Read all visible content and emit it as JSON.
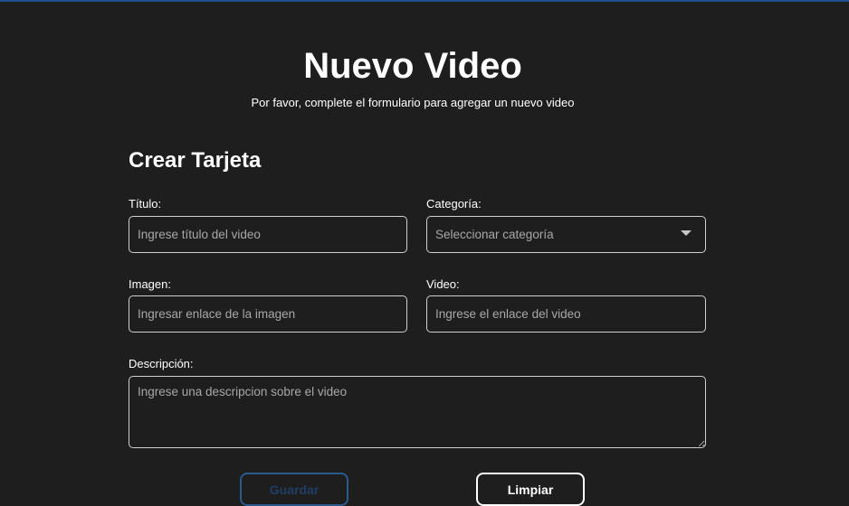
{
  "header": {
    "title": "Nuevo Video",
    "subtitle": "Por favor, complete el formulario para agregar un nuevo video"
  },
  "form": {
    "heading": "Crear Tarjeta",
    "title_field": {
      "label": "Título:",
      "placeholder": "Ingrese título del video",
      "value": ""
    },
    "category_field": {
      "label": "Categoría:",
      "selected": "Seleccionar categoría"
    },
    "image_field": {
      "label": "Imagen:",
      "placeholder": "Ingresar enlace de la imagen",
      "value": ""
    },
    "video_field": {
      "label": "Video:",
      "placeholder": "Ingrese el enlace del video",
      "value": ""
    },
    "description_field": {
      "label": "Descripción:",
      "placeholder": "Ingrese una descripcion sobre el video",
      "value": ""
    },
    "buttons": {
      "save_label": "Guardar",
      "clear_label": "Limpiar"
    }
  },
  "colors": {
    "background": "#1e1e1e",
    "top_border": "#1f4f8f",
    "save_border": "#2a5a8c",
    "text": "#ffffff",
    "placeholder": "#a8a8a8"
  }
}
